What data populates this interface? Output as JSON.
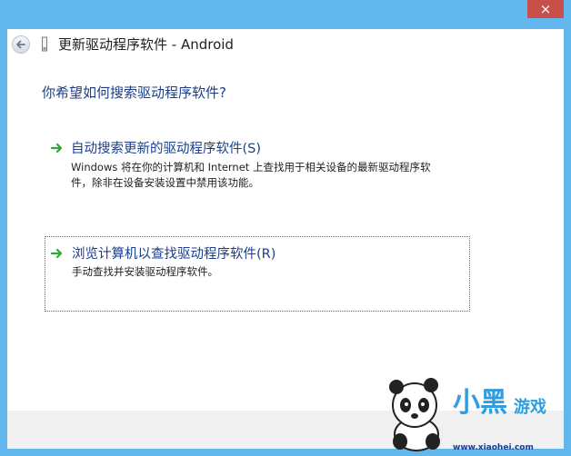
{
  "window": {
    "close_glyph": "×",
    "title": "更新驱动程序软件 - Android"
  },
  "main": {
    "question": "你希望如何搜索驱动程序软件?",
    "options": [
      {
        "title": "自动搜索更新的驱动程序软件(S)",
        "desc_line1": "Windows 将在你的计算机和 Internet 上查找用于相关设备的最新驱动程序软",
        "desc_line2": "件，除非在设备安装设置中禁用该功能。"
      },
      {
        "title": "浏览计算机以查找驱动程序软件(R)",
        "desc_line1": "手动查找并安装驱动程序软件。"
      }
    ]
  },
  "watermark": {
    "logo_text": "小黑",
    "logo_sub": "游戏",
    "url": "www.xiaohei.com"
  },
  "colors": {
    "frame": "#62b7ec",
    "close": "#c7504a",
    "link_blue": "#1b3e8c",
    "arrow_green": "#2fa836"
  }
}
